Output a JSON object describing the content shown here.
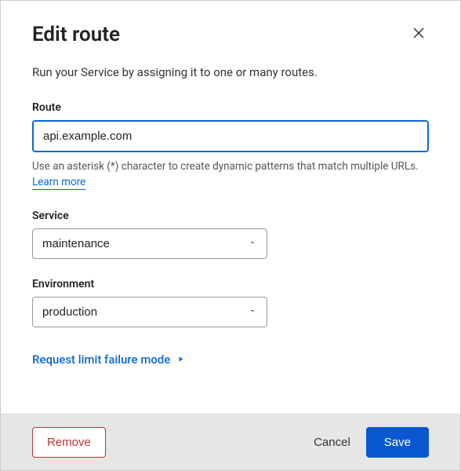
{
  "dialog": {
    "title": "Edit route",
    "description": "Run your Service by assigning it to one or many routes."
  },
  "fields": {
    "route": {
      "label": "Route",
      "value": "api.example.com",
      "help_prefix": "Use an asterisk (*) character to create dynamic patterns that match multiple URLs. ",
      "learn_more": "Learn more"
    },
    "service": {
      "label": "Service",
      "value": "maintenance"
    },
    "environment": {
      "label": "Environment",
      "value": "production"
    }
  },
  "expand": {
    "label": "Request limit failure mode"
  },
  "footer": {
    "remove": "Remove",
    "cancel": "Cancel",
    "save": "Save"
  }
}
